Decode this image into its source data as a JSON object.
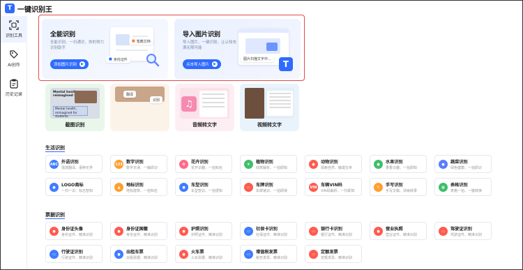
{
  "app": {
    "name": "一键识别王",
    "logo_letter": "T"
  },
  "rail": [
    {
      "label": "识别工具",
      "icon": "scan-icon",
      "active": true
    },
    {
      "label": "AI创作",
      "icon": "tag-icon",
      "active": false
    },
    {
      "label": "历史记录",
      "icon": "clipboard-icon",
      "active": false
    }
  ],
  "hero": {
    "left": {
      "title": "全能识别",
      "subtitle": "全能识别、一扫通识、你的得力识别助手",
      "button": "添加图片识别",
      "chip1": "身份证件",
      "chip2": "笔籍文档"
    },
    "right": {
      "title": "导入图片识别",
      "subtitle": "导入图片、一键识别、让认知充满无限可能",
      "button": "点击导入图片",
      "chip": "图片扫描文字中..."
    }
  },
  "tools": [
    {
      "label": "截图识别",
      "bg": "#e8f7ea",
      "art": "#d8dde6"
    },
    {
      "label": "",
      "bg": "#fbf3e8",
      "art": "#c9a58a"
    },
    {
      "label": "音频转文字",
      "bg": "#fdeef3",
      "art": "#f7c8d6"
    },
    {
      "label": "视频转文字",
      "bg": "#e9f3fb",
      "art": "#d7e3ee"
    }
  ],
  "tool_art_text": {
    "screenshot_lines": [
      "Mental health,",
      "reimagined for",
      "Mental health,",
      "reimagined for students"
    ],
    "camera_chip1": "翻译",
    "camera_chip2": "识别"
  },
  "sections": {
    "life": "生活识别",
    "docs": "票据识别"
  },
  "life_cards": [
    {
      "title": "外语识别",
      "sub": "语境翻译、语种无界",
      "color": "#3f7cff",
      "glyph": "ABC"
    },
    {
      "title": "数字识别",
      "sub": "数字无误、一触即识",
      "color": "#ff9f2f",
      "glyph": "123"
    },
    {
      "title": "花卉识别",
      "sub": "花开识趣、一拍知名",
      "color": "#ff6a8a",
      "glyph": "✿"
    },
    {
      "title": "植物识别",
      "sub": "绿意解析、一拍即知",
      "color": "#3fbf6a",
      "glyph": "❦"
    },
    {
      "title": "动物识别",
      "sub": "探索自然、触摸生命",
      "color": "#ff5b4f",
      "glyph": "●"
    },
    {
      "title": "水果识别",
      "sub": "果香识趣、一拍即知",
      "color": "#3fbf6a",
      "glyph": "●"
    },
    {
      "title": "蔬菜识别",
      "sub": "绿色健康、一拍即识",
      "color": "#5b7cff",
      "glyph": "●"
    },
    {
      "title": "LOGO商标",
      "sub": "一扫一识、标志智知",
      "color": "#3f7cff",
      "glyph": "●"
    },
    {
      "title": "地标识别",
      "sub": "地标建筑、一拍知名",
      "color": "#ff9f2f",
      "glyph": "▲"
    },
    {
      "title": "车型识别",
      "sub": "车型智识、一拍便知",
      "color": "#3f7cff",
      "glyph": "●"
    },
    {
      "title": "车牌识别",
      "sub": "车牌速识、一拍即得",
      "color": "#ff5b4f",
      "glyph": "▭"
    },
    {
      "title": "车辆VIN码",
      "sub": "VIN码解析、一扫即知",
      "color": "#ff5b4f",
      "glyph": "VIN"
    },
    {
      "title": "手写识别",
      "sub": "手写文稿、清晰转录",
      "color": "#ff9f2f",
      "glyph": "✎"
    },
    {
      "title": "表格识别",
      "sub": "表格一拍、一键转换",
      "color": "#3fbf6a",
      "glyph": "▦"
    }
  ],
  "doc_cards": [
    {
      "title": "身份证头像",
      "sub": "身份证件、精准识别",
      "color": "#ff5b4f",
      "glyph": "●"
    },
    {
      "title": "身份证国徽",
      "sub": "身份证件、精准识别",
      "color": "#ff5b4f",
      "glyph": "●"
    },
    {
      "title": "护照识别",
      "sub": "护照证件、精准识别",
      "color": "#ff5b4f",
      "glyph": "●"
    },
    {
      "title": "社保卡识别",
      "sub": "社保证件、精准识别",
      "color": "#3f7cff",
      "glyph": "▭"
    },
    {
      "title": "银行卡识别",
      "sub": "银行证件、精准识别",
      "color": "#ff5b4f",
      "glyph": "▭"
    },
    {
      "title": "营业执照",
      "sub": "营业证件、精准识别",
      "color": "#ff5b4f",
      "glyph": "●"
    },
    {
      "title": "驾驶证识别",
      "sub": "驾驶证件、精准识别",
      "color": "#ff5b4f",
      "glyph": "▭"
    },
    {
      "title": "行驶证识别",
      "sub": "行驶证件、精准识别",
      "color": "#3f7cff",
      "glyph": "▭"
    },
    {
      "title": "出租车票",
      "sub": "出租票据、精准识别",
      "color": "#3f7cff",
      "glyph": "●"
    },
    {
      "title": "火车票",
      "sub": "火车票据、精准识别",
      "color": "#ff5b4f",
      "glyph": "●"
    },
    {
      "title": "增值税发票",
      "sub": "税务发票、精准识别",
      "color": "#3f7cff",
      "glyph": "▭"
    },
    {
      "title": "定额发票",
      "sub": "定额发票、精准识别",
      "color": "#ff5b4f",
      "glyph": "▭"
    }
  ]
}
